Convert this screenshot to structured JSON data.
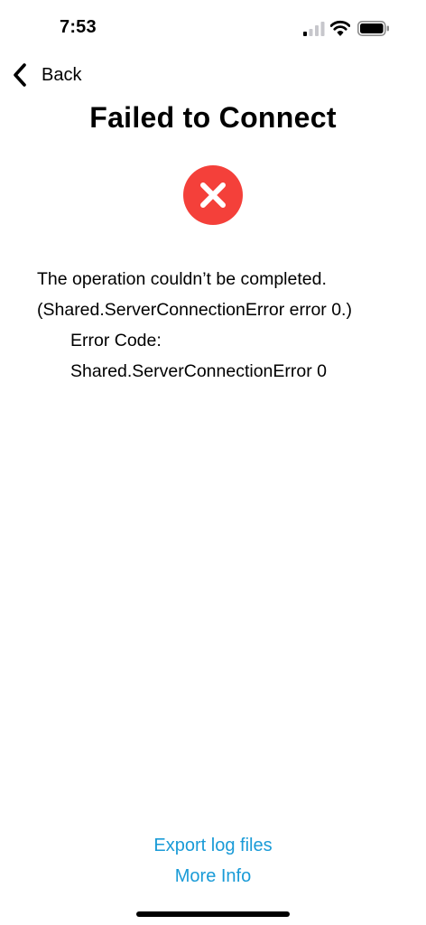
{
  "status_bar": {
    "time": "7:53",
    "icons": [
      "cellular-signal-icon",
      "wifi-icon",
      "battery-icon"
    ]
  },
  "nav": {
    "back_label": "Back",
    "back_icon": "chevron-left-icon"
  },
  "page": {
    "title": "Failed to Connect",
    "status_icon": "error-x-circle-icon",
    "status_color": "#f4403a"
  },
  "message": {
    "line1": "The operation couldn’t be completed.",
    "line2": "(Shared.ServerConnectionError error 0.)",
    "error_code_label": "Error Code:",
    "error_code_value": "Shared.ServerConnectionError 0"
  },
  "footer": {
    "export_logs_label": "Export log files",
    "more_info_label": "More Info",
    "link_color": "#1a9bd7"
  }
}
